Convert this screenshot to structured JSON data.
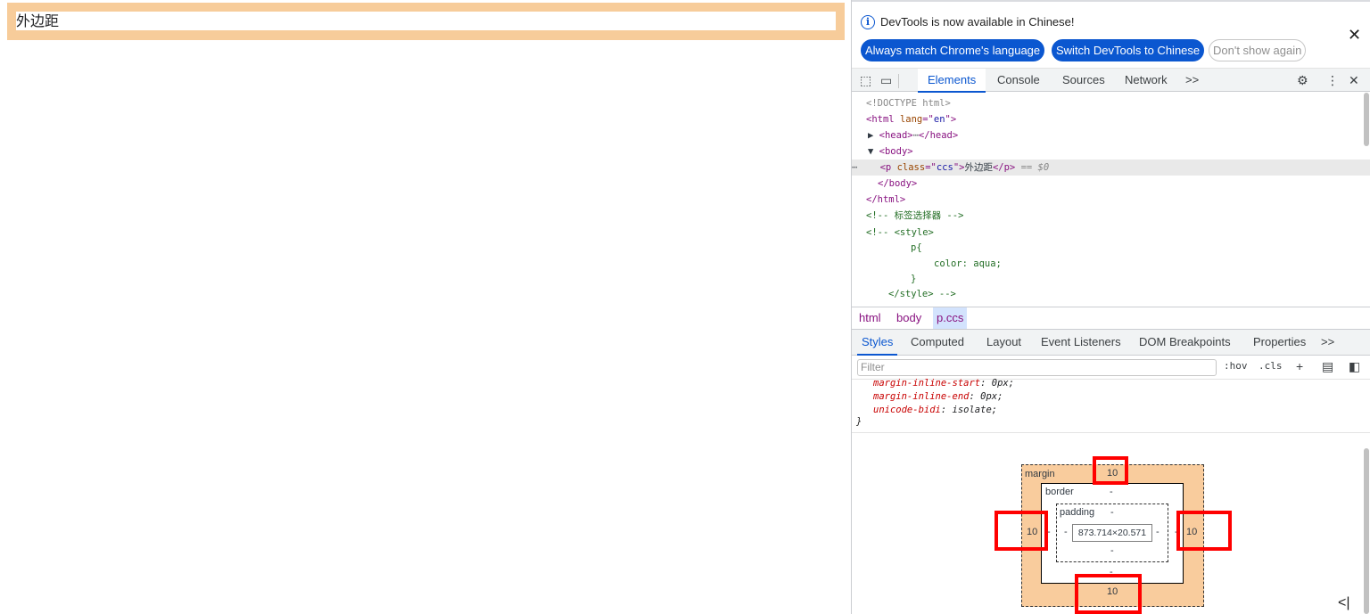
{
  "page": {
    "text": "外边距"
  },
  "infobar": {
    "message": "DevTools is now available in Chinese!",
    "btn_match": "Always match Chrome's language",
    "btn_switch": "Switch DevTools to Chinese",
    "btn_dont_show": "Don't show again",
    "close": "✕"
  },
  "toolbar": {
    "tabs": [
      "Elements",
      "Console",
      "Sources",
      "Network",
      ">>"
    ],
    "active_tab": "Elements"
  },
  "elements": {
    "lines": {
      "doctype": "<!DOCTYPE html>",
      "html_open_tag": "<html ",
      "html_attr": "lang",
      "html_eq": "=\"",
      "html_val": "en",
      "html_close": "\">",
      "head": "<head>",
      "head_close": "</head>",
      "body_open": "<body>",
      "p_open": "<p ",
      "p_attr": "class",
      "p_eq": "=\"",
      "p_val": "ccs",
      "p_gt": "\">",
      "p_text": "外边距",
      "p_close": "</p>",
      "p_marker": " == $0",
      "body_close": "</body>",
      "html_close_tag": "</html>",
      "comment1": "<!-- 标签选择器 -->",
      "comment2": "<!-- <style>",
      "comment3": "p{",
      "comment4": "color: aqua;",
      "comment5": "}",
      "comment6": "</style> -->"
    }
  },
  "breadcrumbs": [
    "html",
    "body",
    "p.ccs"
  ],
  "subtabs": [
    "Styles",
    "Computed",
    "Layout",
    "Event Listeners",
    "DOM Breakpoints",
    "Properties",
    ">>"
  ],
  "filter": {
    "placeholder": "Filter",
    "hov": ":hov",
    "cls": ".cls"
  },
  "styles": {
    "rules": [
      {
        "prop": "margin-inline-start",
        "value": "0px;"
      },
      {
        "prop": "margin-inline-end",
        "value": "0px;"
      },
      {
        "prop": "unicode-bidi",
        "value": "isolate;"
      }
    ],
    "closing_brace": "}"
  },
  "box_model": {
    "margin_label": "margin",
    "border_label": "border",
    "padding_label": "padding",
    "margin_top": "10",
    "margin_left": "10",
    "margin_right": "10",
    "margin_bottom": "10",
    "border_top": "-",
    "border_left": "-",
    "border_right": "-",
    "border_bottom": "-",
    "padding_top": "-",
    "padding_left": "-",
    "padding_right": "-",
    "padding_bottom": "-",
    "content_size": "873.714×20.571",
    "highlight_color": "#ff0000",
    "margin_color": "#f9cc9d"
  }
}
